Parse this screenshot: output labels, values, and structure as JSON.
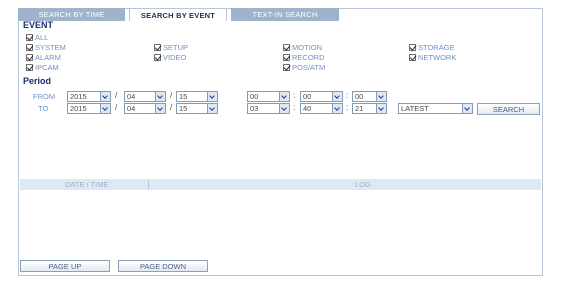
{
  "tabs": [
    {
      "label": "SEARCH BY TIME",
      "active": false
    },
    {
      "label": "SEARCH BY EVENT",
      "active": true
    },
    {
      "label": "TEXT-IN SEARCH",
      "active": false
    }
  ],
  "event": {
    "title": "EVENT",
    "checkboxes": {
      "all": "ALL",
      "system": "SYSTEM",
      "alarm": "ALARM",
      "ipcam": "IPCAM",
      "setup": "SETUP",
      "video": "VIDEO",
      "motion": "MOTION",
      "record": "RECORD",
      "pos_atm": "POS/ATM",
      "storage": "STORAGE",
      "network": "NETWORK"
    }
  },
  "period": {
    "title": "Period",
    "from_label": "FROM",
    "to_label": "TO",
    "from": {
      "year": "2015",
      "month": "04",
      "day": "15",
      "hour": "00",
      "minute": "00",
      "second": "00"
    },
    "to": {
      "year": "2015",
      "month": "04",
      "day": "15",
      "hour": "03",
      "minute": "40",
      "second": "21"
    },
    "date_sep": "/",
    "time_sep": ":",
    "sort": "LATEST",
    "search_label": "SEARCH"
  },
  "log_table": {
    "col_datetime": "DATE / TIME",
    "col_log": "LOG"
  },
  "footer": {
    "page_up": "PAGE UP",
    "page_down": "PAGE DOWN"
  }
}
